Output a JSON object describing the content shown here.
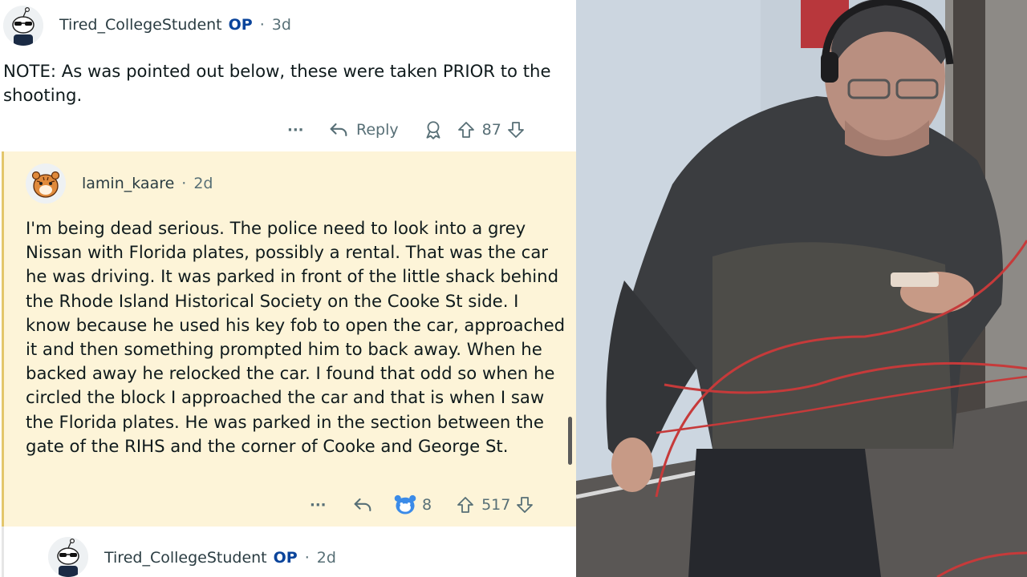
{
  "comment_1": {
    "username": "Tired_CollegeStudent",
    "op_badge": "OP",
    "separator": "·",
    "age": "3d",
    "body": "NOTE: As was pointed out below, these were taken PRIOR to the shooting.",
    "actions": {
      "more": "···",
      "reply": "Reply",
      "upvotes": "87"
    }
  },
  "comment_2": {
    "username": "lamin_kaare",
    "separator": "·",
    "age": "2d",
    "body": "I'm being dead serious. The police need to look into a grey Nissan with Florida plates, possibly a rental. That was the car he was driving. It was parked in front of the little shack behind the Rhode Island Historical Society on the Cooke St side. I know because he used his key fob to open the car, approached it and then something prompted him to back away. When he backed away he relocked the car. I found that odd so when he circled the block I approached the car and that is when I saw the Florida plates. He was parked in the section between the gate of the RIHS and the corner of Cooke and George St.",
    "actions": {
      "more": "···",
      "award_count": "8",
      "upvotes": "517"
    },
    "highlight_color": "#fdf4d8"
  },
  "comment_3": {
    "username": "Tired_CollegeStudent",
    "op_badge": "OP",
    "separator": "·",
    "age": "2d"
  },
  "icons": {
    "avatar_op": "snoo-sunglasses-avatar",
    "avatar_reply": "snoo-tiger-avatar",
    "reply": "reply-arrow-icon",
    "award": "award-icon",
    "upvote": "upvote-arrow-icon",
    "downvote": "downvote-arrow-icon",
    "more": "more-dots-icon"
  },
  "colors": {
    "op_badge": "#0a449b",
    "meta_text": "#576f76",
    "body_text": "#0f1a1c"
  }
}
